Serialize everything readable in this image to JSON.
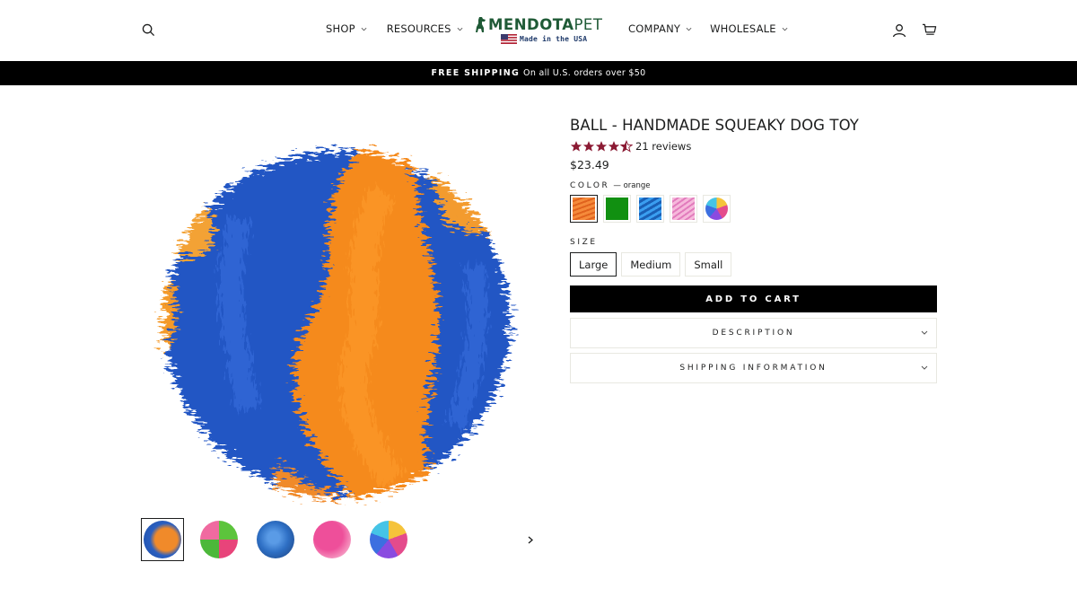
{
  "header": {
    "nav_left": [
      {
        "label": "SHOP",
        "has_dropdown": true
      },
      {
        "label": "RESOURCES",
        "has_dropdown": true
      }
    ],
    "nav_right": [
      {
        "label": "COMPANY",
        "has_dropdown": true
      },
      {
        "label": "WHOLESALE",
        "has_dropdown": true
      }
    ],
    "logo": {
      "brand_bold": "MENDOTA",
      "brand_light": "PET",
      "tagline": "Made in the USA",
      "brand_color": "#1f5a36"
    },
    "icons": [
      "search-icon",
      "account-icon",
      "cart-icon"
    ]
  },
  "announcement": {
    "strong": "FREE SHIPPING",
    "rest": "On all U.S. orders over $50"
  },
  "product": {
    "title": "BALL - HANDMADE SQUEAKY DOG TOY",
    "rating": 4.5,
    "reviews_label": "21 reviews",
    "star_color": "#8b1a33",
    "price": "$23.49",
    "color_label": "COLOR",
    "color_selected": "— orange",
    "color_options": [
      {
        "name": "orange",
        "colors": [
          "#f07a2f",
          "#e0621d"
        ]
      },
      {
        "name": "green",
        "colors": [
          "#1a8f1a",
          "#0f7a10"
        ]
      },
      {
        "name": "blue",
        "colors": [
          "#2f8fe0",
          "#1a5fb5"
        ]
      },
      {
        "name": "pink",
        "colors": [
          "#f3a6d2",
          "#e27cbd"
        ]
      },
      {
        "name": "multicolor",
        "colors": [
          "#f5c33b",
          "#e44b8c",
          "#3c6fe0"
        ]
      }
    ],
    "size_label": "SIZE",
    "sizes": [
      "Large",
      "Medium",
      "Small"
    ],
    "selected_size": "Large",
    "add_to_cart": "ADD TO CART",
    "accordions": [
      "DESCRIPTION",
      "SHIPPING INFORMATION"
    ]
  },
  "gallery": {
    "thumbnails": [
      {
        "name": "orange-blue",
        "colors": [
          "#f08a2a",
          "#2a5fc0"
        ]
      },
      {
        "name": "green-pink",
        "colors": [
          "#5cc43c",
          "#e8447a"
        ]
      },
      {
        "name": "blue",
        "colors": [
          "#2e6fc4",
          "#1c3f7a"
        ]
      },
      {
        "name": "pink",
        "colors": [
          "#ee4f9a",
          "#f6a6c8"
        ]
      },
      {
        "name": "rainbow",
        "colors": [
          "#f5c33b",
          "#e44b8c",
          "#3c6fe0"
        ]
      }
    ],
    "next_icon": "chevron-right-icon"
  }
}
